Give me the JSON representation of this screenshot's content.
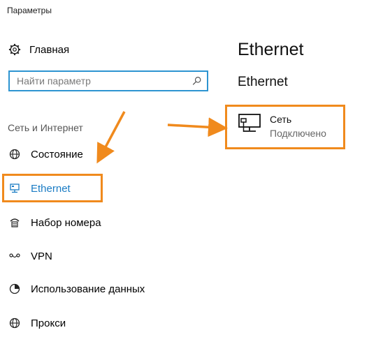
{
  "window": {
    "title": "Параметры"
  },
  "home": {
    "label": "Главная",
    "icon": "gear-icon"
  },
  "search": {
    "placeholder": "Найти параметр",
    "icon": "search-icon"
  },
  "sidebar": {
    "section_title": "Сеть и Интернет",
    "items": [
      {
        "label": "Состояние",
        "icon": "globe-icon"
      },
      {
        "label": "Ethernet",
        "icon": "ethernet-icon",
        "active": true
      },
      {
        "label": "Набор номера",
        "icon": "dialup-icon"
      },
      {
        "label": "VPN",
        "icon": "vpn-icon"
      },
      {
        "label": "Использование данных",
        "icon": "data-usage-icon"
      },
      {
        "label": "Прокси",
        "icon": "globe-icon"
      }
    ]
  },
  "content": {
    "title": "Ethernet",
    "subtitle": "Ethernet",
    "network": {
      "name": "Сеть",
      "status": "Подключено",
      "icon": "network-computer-icon"
    }
  },
  "colors": {
    "accent": "#1a7cc4",
    "search_border": "#2d94d1",
    "annotation": "#f08a1d"
  }
}
